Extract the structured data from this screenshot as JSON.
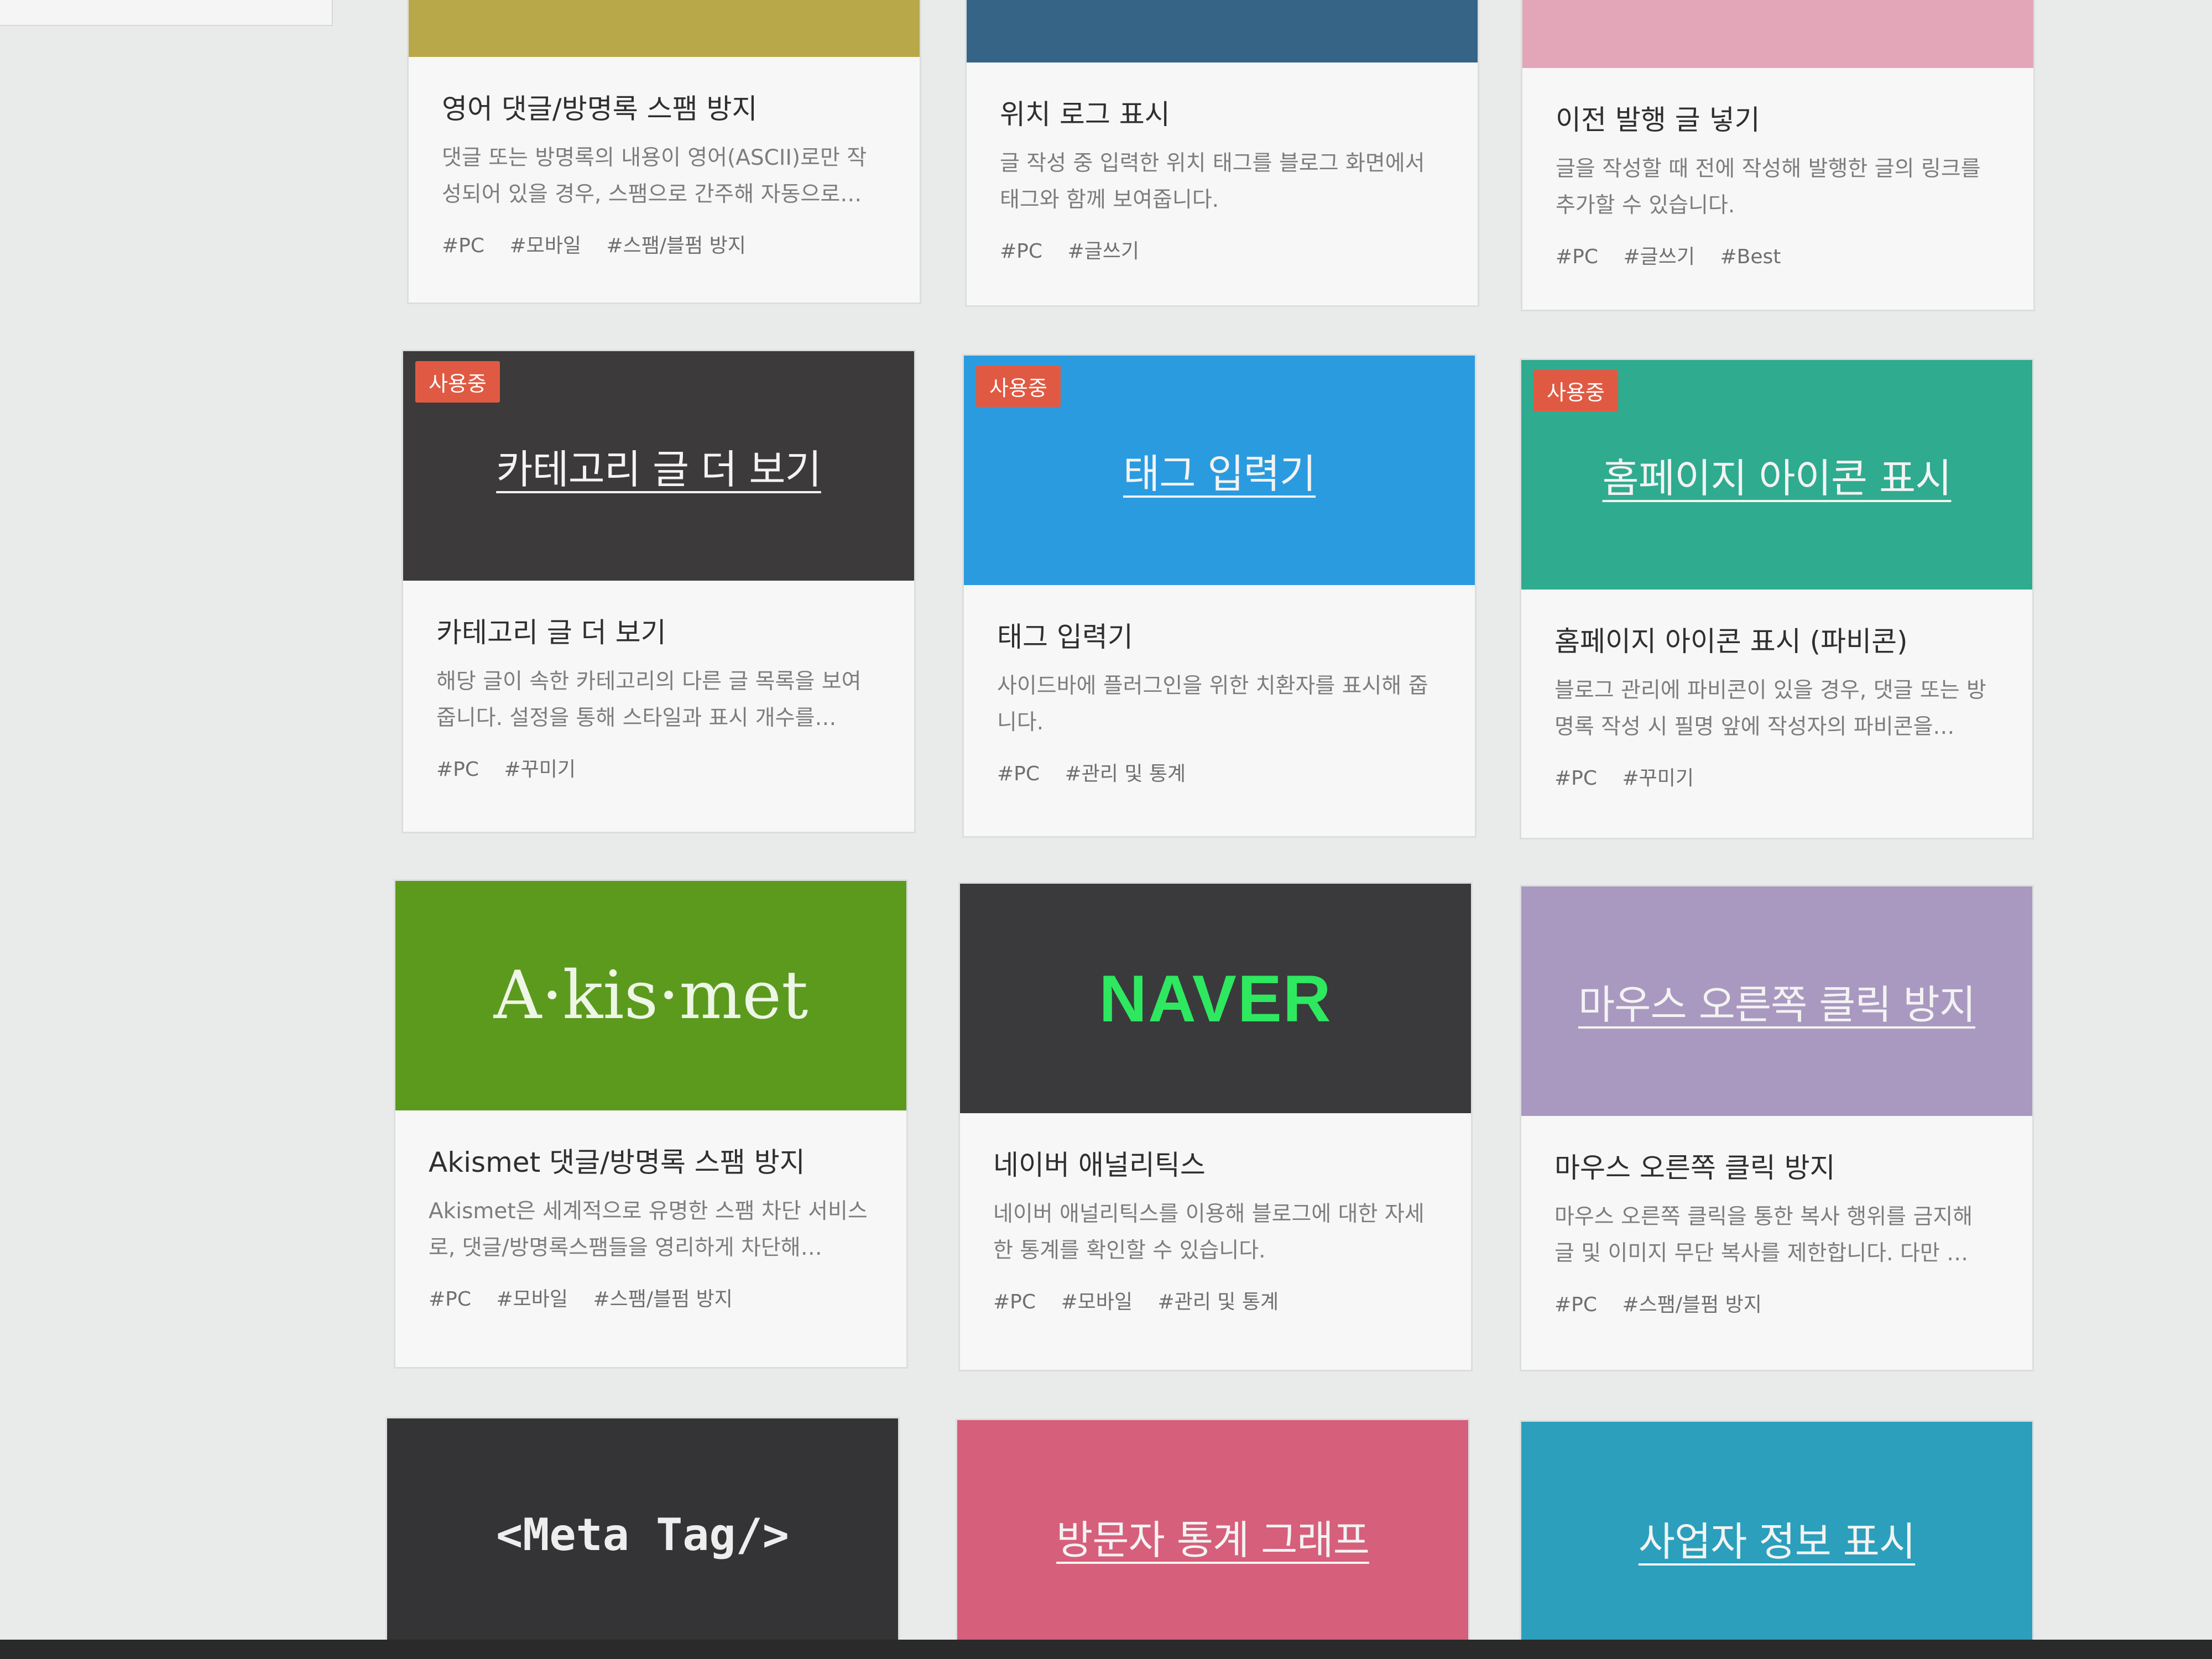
{
  "cards": [
    {
      "title": "영어 댓글/방명록 스팸 방지",
      "desc": "댓글 또는 방명록의 내용이 영어(ASCII)로만 작성되어 있을 경우, 스팸으로 간주해 자동으로…",
      "tags": [
        "#PC",
        "#모바일",
        "#스팸/블펌 방지"
      ],
      "color": "#b8a84a"
    },
    {
      "title": "위치 로그 표시",
      "desc": "글 작성 중 입력한 위치 태그를 블로그 화면에서 태그와 함께 보여줍니다.",
      "tags": [
        "#PC",
        "#글쓰기"
      ],
      "color": "#356487"
    },
    {
      "title": "이전 발행 글 넣기",
      "desc": "글을 작성할 때 전에 작성해 발행한 글의 링크를 추가할 수 있습니다.",
      "tags": [
        "#PC",
        "#글쓰기",
        "#Best"
      ],
      "color": "#e3a6b8"
    },
    {
      "badge": "사용중",
      "thumb_title": "카테고리 글 더 보기",
      "title": "카테고리 글 더 보기",
      "desc": "해당 글이 속한 카테고리의 다른 글 목록을 보여줍니다. 설정을 통해 스타일과 표시 개수를…",
      "tags": [
        "#PC",
        "#꾸미기"
      ],
      "color": "#3c3a3b"
    },
    {
      "badge": "사용중",
      "thumb_title": "태그 입력기",
      "title": "태그 입력기",
      "desc": "사이드바에 플러그인을 위한 치환자를 표시해 줍니다.",
      "tags": [
        "#PC",
        "#관리 및 통계"
      ],
      "color": "#2b9be0"
    },
    {
      "badge": "사용중",
      "thumb_title": "홈페이지 아이콘 표시",
      "title": "홈페이지 아이콘 표시 (파비콘)",
      "desc": "블로그 관리에 파비콘이 있을 경우, 댓글 또는 방명록 작성 시 필명 앞에 작성자의 파비콘을…",
      "tags": [
        "#PC",
        "#꾸미기"
      ],
      "color": "#2fab8f"
    },
    {
      "logo": "A·kis·met",
      "title": "Akismet 댓글/방명록 스팸 방지",
      "desc": "Akismet은 세계적으로 유명한 스팸 차단 서비스로, 댓글/방명록스팸들을 영리하게 차단해…",
      "tags": [
        "#PC",
        "#모바일",
        "#스팸/블펌 방지"
      ],
      "color": "#5c9a1e"
    },
    {
      "logo": "NAVER",
      "title": "네이버 애널리틱스",
      "desc": "네이버 애널리틱스를 이용해 블로그에 대한 자세한 통계를 확인할 수 있습니다.",
      "tags": [
        "#PC",
        "#모바일",
        "#관리 및 통계"
      ],
      "color": "#3a3a3c"
    },
    {
      "thumb_title": "마우스 오른쪽 클릭 방지",
      "title": "마우스 오른쪽 클릭 방지",
      "desc": "마우스 오른쪽 클릭을 통한 복사 행위를 금지해 글 및 이미지 무단 복사를 제한합니다. 다만 …",
      "tags": [
        "#PC",
        "#스팸/블펌 방지"
      ],
      "color": "#a999c0"
    },
    {
      "logo": "<Meta Tag/>",
      "color": "#343335"
    },
    {
      "thumb_title": "방문자 통계 그래프",
      "color": "#d65f7b"
    },
    {
      "thumb_title": "사업자 정보 표시",
      "color": "#2b9fbc"
    }
  ]
}
